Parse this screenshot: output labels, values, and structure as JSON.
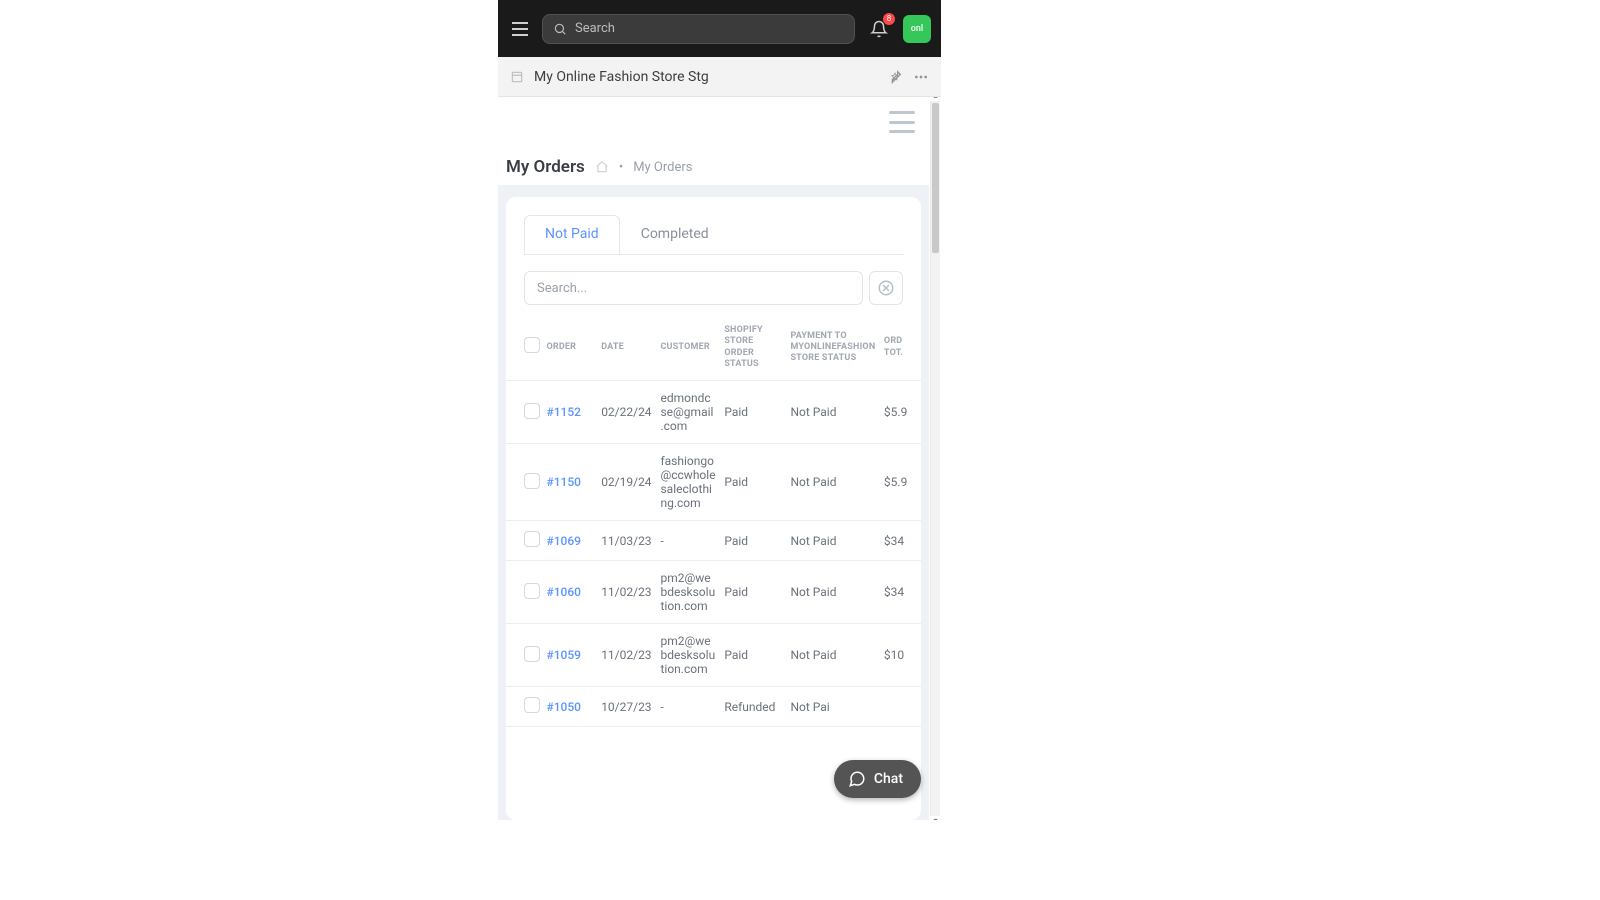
{
  "topbar": {
    "search_placeholder": "Search",
    "notification_count": "8",
    "avatar_label": "onl"
  },
  "storebar": {
    "title": "My Online Fashion Store Stg"
  },
  "page": {
    "title": "My Orders",
    "breadcrumb_sep": "•",
    "breadcrumb": "My Orders"
  },
  "tabs": {
    "not_paid": "Not Paid",
    "completed": "Completed"
  },
  "search": {
    "placeholder": "Search..."
  },
  "table": {
    "headers": {
      "order": "ORDER",
      "date": "DATE",
      "customer": "CUSTOMER",
      "shopify": "SHOPIFY STORE ORDER STATUS",
      "payment": "PAYMENT TO MYONLINEFASHION STORE STATUS",
      "total": "ORD TOT."
    },
    "rows": [
      {
        "order": "#1152",
        "date": "02/22/24",
        "customer": "edmondcse@gmail.com",
        "shopify": "Paid",
        "payment": "Not Paid",
        "total": "$5.9"
      },
      {
        "order": "#1150",
        "date": "02/19/24",
        "customer": "fashiongo@ccwholesaleclothing.com",
        "shopify": "Paid",
        "payment": "Not Paid",
        "total": "$5.9"
      },
      {
        "order": "#1069",
        "date": "11/03/23",
        "customer": "-",
        "shopify": "Paid",
        "payment": "Not Paid",
        "total": "$34"
      },
      {
        "order": "#1060",
        "date": "11/02/23",
        "customer": "pm2@webdesksolution.com",
        "shopify": "Paid",
        "payment": "Not Paid",
        "total": "$34"
      },
      {
        "order": "#1059",
        "date": "11/02/23",
        "customer": "pm2@webdesksolution.com",
        "shopify": "Paid",
        "payment": "Not Paid",
        "total": "$10"
      },
      {
        "order": "#1050",
        "date": "10/27/23",
        "customer": "-",
        "shopify": "Refunded",
        "payment": "Not Pai",
        "total": ""
      }
    ]
  },
  "chat": {
    "label": "Chat"
  }
}
